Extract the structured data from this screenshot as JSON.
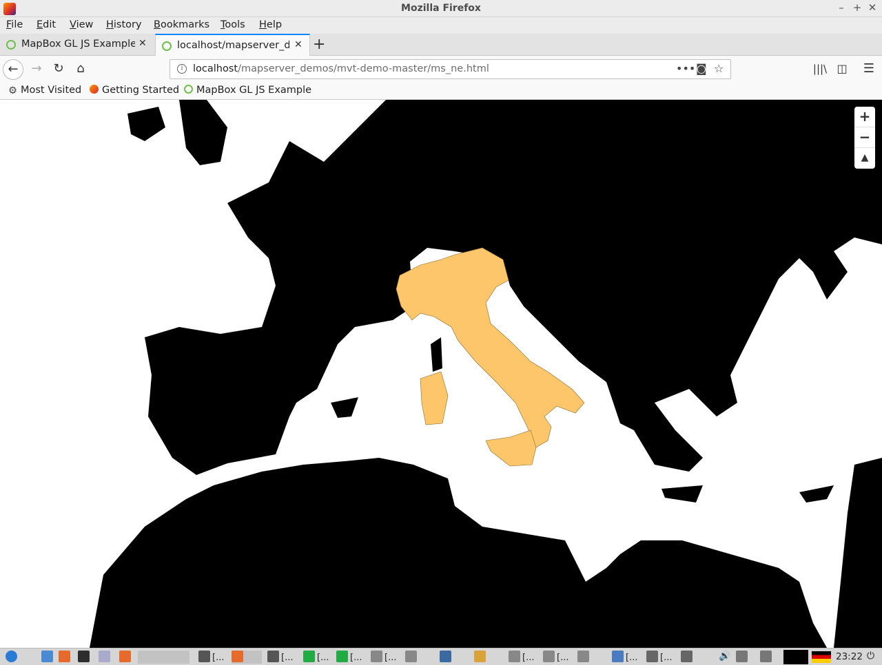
{
  "window": {
    "title": "Mozilla Firefox"
  },
  "menu": [
    "File",
    "Edit",
    "View",
    "History",
    "Bookmarks",
    "Tools",
    "Help"
  ],
  "tabs": [
    {
      "label": "MapBox GL JS Example",
      "active": false
    },
    {
      "label": "localhost/mapserver_de",
      "active": true
    }
  ],
  "url": {
    "host": "localhost",
    "path": "/mapserver_demos/mvt-demo-master/ms_ne.html"
  },
  "bookmarks": [
    "Most Visited",
    "Getting Started",
    "MapBox GL JS Example"
  ],
  "map": {
    "land_color": "#000000",
    "sea_color": "#ffffff",
    "highlight_color": "#fdc66b",
    "highlight_country": "Italy"
  },
  "map_controls": {
    "zoom_in": "+",
    "zoom_out": "−",
    "compass": "▲"
  },
  "taskbar": {
    "items": [
      "[...",
      "[...",
      "[...",
      "[...",
      "[...",
      "[...",
      "[...",
      "[...",
      "[..."
    ],
    "clock": "23:22"
  },
  "colors": {
    "accent": "#0a84ff"
  }
}
